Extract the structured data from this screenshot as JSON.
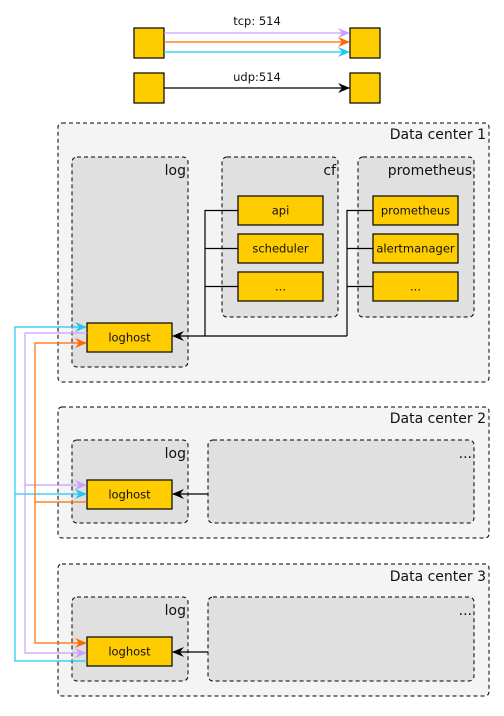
{
  "legend": [
    {
      "label": "tcp: 514",
      "colors": [
        "#c9a0ff",
        "#ff6a00",
        "#1ec8f5"
      ]
    },
    {
      "label": "udp:514",
      "colors": [
        "#000000"
      ]
    }
  ],
  "colors": {
    "node": "#ffcc00",
    "purple": "#c9a0ff",
    "orange": "#ff6a00",
    "cyan": "#1ec8f5",
    "udp": "#000000"
  },
  "datacenters": [
    {
      "title": "Data center 1",
      "groups": [
        {
          "title": "log",
          "nodes": [
            "loghost"
          ]
        },
        {
          "title": "cf",
          "nodes": [
            "api",
            "scheduler",
            "..."
          ]
        },
        {
          "title": "prometheus",
          "nodes": [
            "prometheus",
            "alertmanager",
            "..."
          ]
        }
      ]
    },
    {
      "title": "Data center 2",
      "groups": [
        {
          "title": "log",
          "nodes": [
            "loghost"
          ]
        },
        {
          "title": "...",
          "nodes": []
        }
      ]
    },
    {
      "title": "Data center 3",
      "groups": [
        {
          "title": "log",
          "nodes": [
            "loghost"
          ]
        },
        {
          "title": "...",
          "nodes": []
        }
      ]
    }
  ]
}
